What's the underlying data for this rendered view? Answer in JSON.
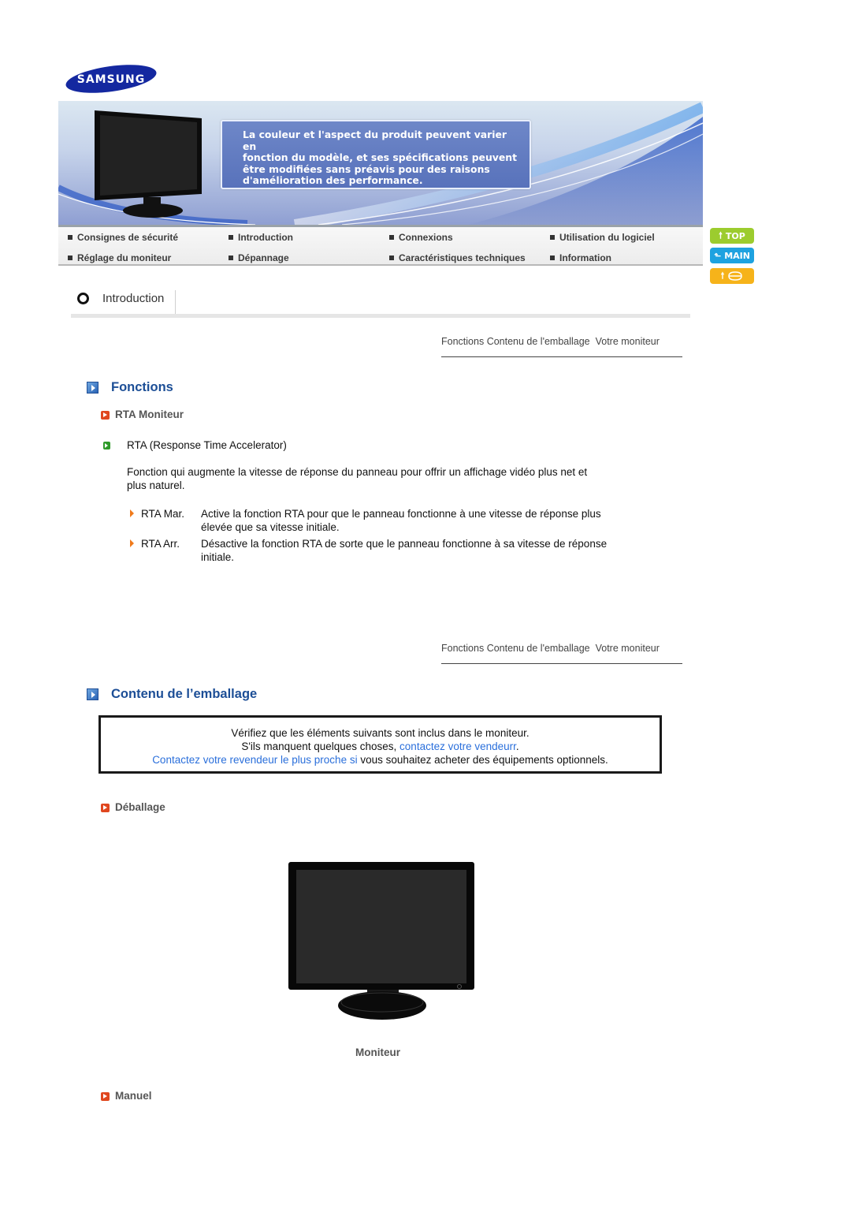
{
  "brand": {
    "logo_text": "SAMSUNG",
    "logo_color": "#1428a0"
  },
  "banner": {
    "notice_lines": [
      "La couleur et l'aspect du produit peuvent varier en",
      "fonction du modèle, et ses spécifications peuvent",
      "être modifiées sans préavis pour des raisons",
      "d'amélioration des performance."
    ]
  },
  "nav": {
    "items": [
      {
        "label": "Consignes de sécurité"
      },
      {
        "label": "Introduction"
      },
      {
        "label": "Connexions"
      },
      {
        "label": "Utilisation du logiciel"
      },
      {
        "label": "Réglage du moniteur"
      },
      {
        "label": "Dépannage"
      },
      {
        "label": "Caractéristiques techniques"
      },
      {
        "label": "Information"
      }
    ]
  },
  "side_buttons": {
    "top": {
      "label": "TOP",
      "icon": "arrow-up-icon",
      "color": "#9ccc2e"
    },
    "main": {
      "label": "MAIN",
      "icon": "turn-arrow-icon",
      "color": "#1ea2e0"
    },
    "print": {
      "label": "",
      "icon": "print-icon",
      "color": "#f6b31a"
    }
  },
  "section": {
    "title": "Introduction"
  },
  "subnav": {
    "items": [
      {
        "label": "Fonctions"
      },
      {
        "label": "Contenu de l'emballage"
      },
      {
        "label": "Votre moniteur"
      }
    ]
  },
  "fonctions": {
    "heading": "Fonctions",
    "subheading": "RTA Moniteur",
    "item_title": "RTA (Response Time Accelerator)",
    "description_lines": [
      "Fonction qui augmente la vitesse de réponse du panneau pour offrir un affichage vidéo plus net et",
      "plus naturel."
    ],
    "options": [
      {
        "term": "RTA Mar.",
        "lines": [
          "Active la fonction RTA pour que le panneau fonctionne à une vitesse de réponse plus",
          "élevée que sa vitesse initiale."
        ]
      },
      {
        "term": "RTA Arr.",
        "lines": [
          "Désactive la fonction RTA de sorte que le panneau fonctionne à sa vitesse de réponse",
          "initiale."
        ]
      }
    ]
  },
  "emballage": {
    "heading": "Contenu de l’emballage",
    "notice": {
      "line1": "Vérifiez que les éléments suivants sont inclus dans le moniteur.",
      "line2_prefix": "S'ils manquent quelques choses, ",
      "line2_link": "contactez votre vendeurr",
      "line2_suffix": ".",
      "line3_link": "Contactez votre revendeur le plus proche si",
      "line3_suffix": " vous souhaitez acheter des équipements optionnels."
    },
    "sub1": "Déballage",
    "monitor_caption": "Moniteur",
    "sub2": "Manuel"
  }
}
